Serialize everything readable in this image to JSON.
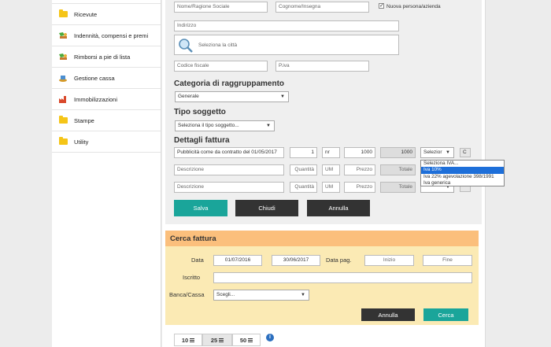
{
  "sidebar": {
    "items": [
      {
        "label": "Ricevute",
        "icon": "folder-icon"
      },
      {
        "label": "Indennità, compensi e premi",
        "icon": "money-icon"
      },
      {
        "label": "Rimborsi a pie di lista",
        "icon": "money-icon"
      },
      {
        "label": "Gestione cassa",
        "icon": "cash-icon"
      },
      {
        "label": "Immobilizzazioni",
        "icon": "factory-icon"
      },
      {
        "label": "Stampe",
        "icon": "folder-icon"
      },
      {
        "label": "Utility",
        "icon": "folder-icon"
      }
    ]
  },
  "form": {
    "nome_placeholder": "Nome/Ragione Sociale",
    "cognome_placeholder": "Cognome/Insegna",
    "nuova_persona_label": "Nuova persona/azienda",
    "indirizzo_placeholder": "Indirizzo",
    "citta_label": "Seleziona la città",
    "codice_fiscale_placeholder": "Codice fiscale",
    "piva_placeholder": "P.iva",
    "categoria_title": "Categoria di raggruppamento",
    "categoria_value": "Generale",
    "tipo_title": "Tipo soggetto",
    "tipo_value": "Seleziona il tipo soggetto...",
    "dettagli_title": "Dettagli fattura",
    "rows": [
      {
        "descrizione": "Pubblicità come da contratto del 01/05/2017",
        "quantita": "1",
        "um": "nr",
        "prezzo": "1000",
        "totale": "1000",
        "iva": "Selezior"
      },
      {
        "descrizione": "Descrizione",
        "quantita": "Quantità",
        "um": "UM",
        "prezzo": "Prezzo",
        "totale": "Totale"
      },
      {
        "descrizione": "Descrizione",
        "quantita": "Quantità",
        "um": "UM",
        "prezzo": "Prezzo",
        "totale": "Totale"
      }
    ],
    "row_button": "C",
    "iva_options": [
      "Seleziona IVA...",
      "Iva 10%",
      "Iva 22% agevolazione 398/1991",
      "Iva generica"
    ],
    "salva": "Salva",
    "chiudi": "Chiudi",
    "annulla": "Annulla"
  },
  "search": {
    "title": "Cerca fattura",
    "data_label": "Data",
    "data_from": "01/07/2016",
    "data_to": "30/06/2017",
    "data_pag_label": "Data pag.",
    "inizio_placeholder": "Inizio",
    "fine_placeholder": "Fine",
    "iscritto_label": "Iscritto",
    "banca_label": "Banca/Cassa",
    "banca_value": "Scegli...",
    "annulla": "Annulla",
    "cerca": "Cerca"
  },
  "pager": {
    "options": [
      "10",
      "25",
      "50"
    ],
    "info": "i"
  },
  "colors": {
    "teal": "#1aa59a",
    "dark": "#333333",
    "search_header": "#fbbf7c",
    "search_bg": "#fbeab4",
    "selected_option": "#1e6fd9"
  }
}
